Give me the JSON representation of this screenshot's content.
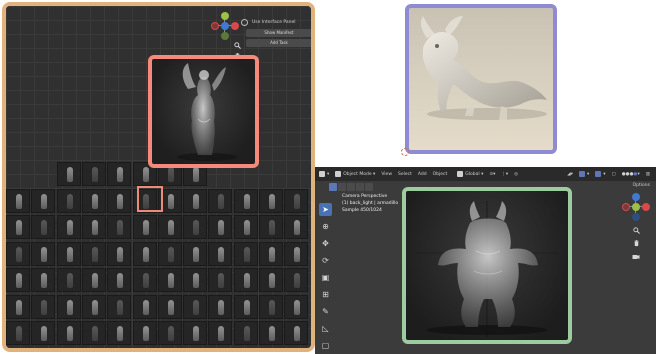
{
  "left_panel": {
    "overlay_menu": {
      "toggle_label": "Use Interface Panel",
      "show_manifest_label": "Show Manifest",
      "add_task_label": "Add Task"
    },
    "thumbnails": {
      "rows": 7,
      "cols": 12,
      "selected_row": 1,
      "selected_col": 5
    }
  },
  "blender": {
    "header": {
      "mode_label": "Object Mode",
      "menus": [
        "View",
        "Select",
        "Add",
        "Object"
      ],
      "transform_label": "Global"
    },
    "options_label": "Options",
    "viewport_info": {
      "line1": "Camera Perspective",
      "line2": "(1) back_light | armadillo",
      "line3": "Sample 450/1024"
    }
  },
  "colors": {
    "left_border": "#e2b27e",
    "render_preview_border": "#f58a7c",
    "top_right_border": "#8f8bd2",
    "viewport_highlight_border": "#9ccc9f",
    "active_tool": "#4772b3"
  },
  "icons": {
    "gizmo": "axis-gizmo-icon",
    "zoom": "magnifier-icon",
    "pan": "hand-icon",
    "toggle": "radio-toggle-icon"
  }
}
